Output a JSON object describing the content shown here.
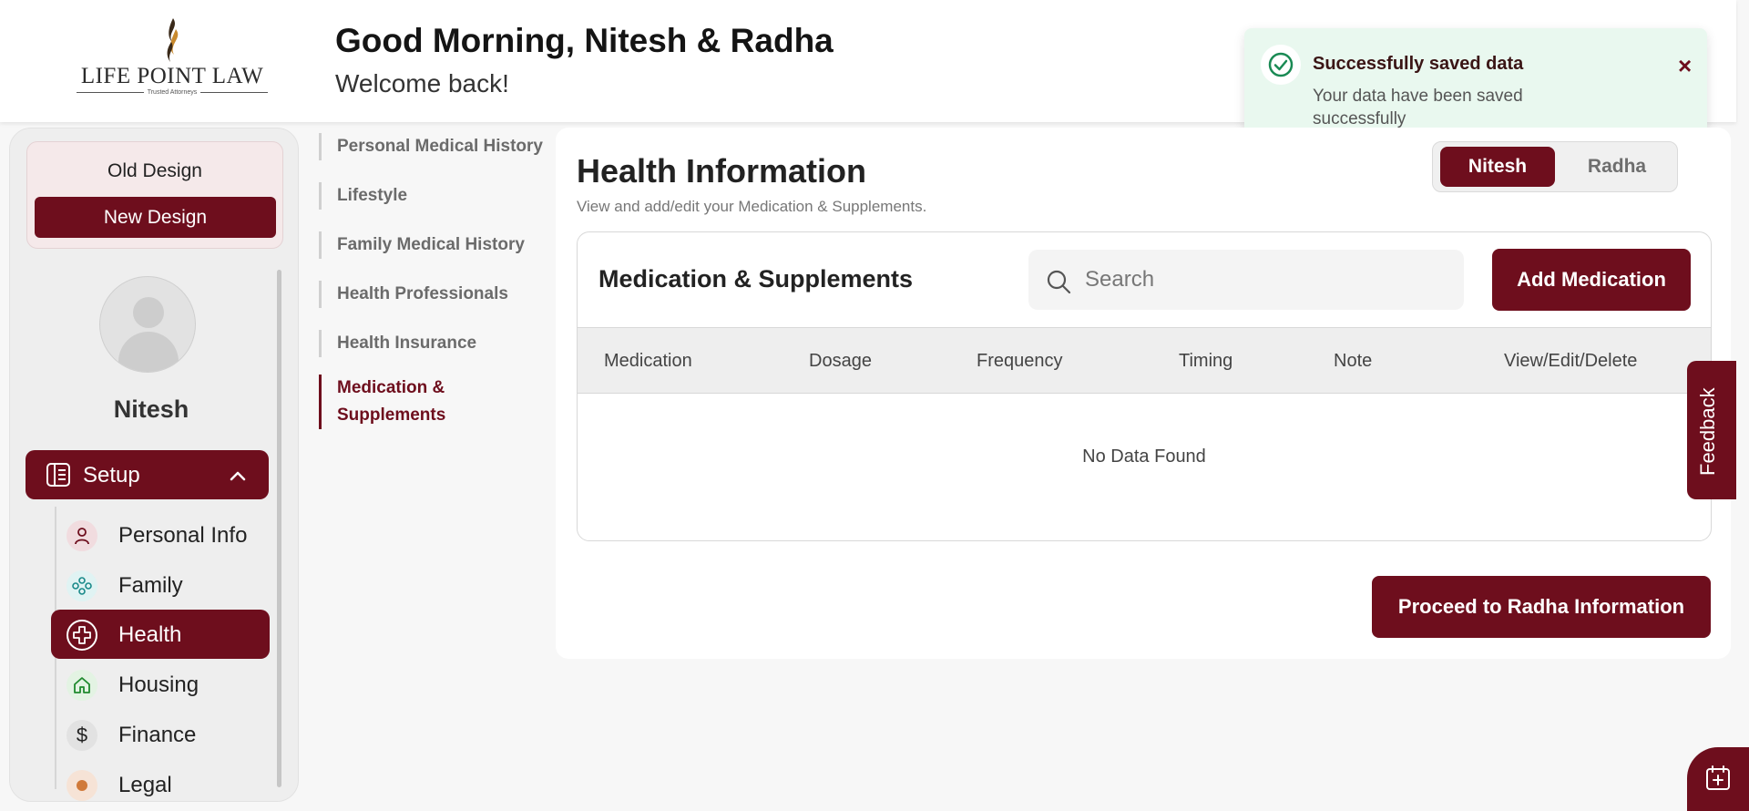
{
  "brand": {
    "logo_text": "LIFE POINT LAW",
    "tagline": "Trusted Attorneys",
    "accent_color": "#6e0e1d"
  },
  "header": {
    "greeting": "Good Morning, Nitesh & Radha",
    "subtitle": "Welcome back!"
  },
  "toast": {
    "title": "Successfully saved data",
    "message": "Your data have been saved successfully",
    "icon": "check-circle-icon",
    "close_label": "×",
    "color": "#e9f8ef"
  },
  "design_switch": {
    "old_label": "Old Design",
    "new_label": "New Design"
  },
  "user": {
    "name": "Nitesh"
  },
  "sidebar": {
    "setup_label": "Setup",
    "items": [
      {
        "label": "Personal Info",
        "icon": "person-icon",
        "active": false
      },
      {
        "label": "Family",
        "icon": "family-icon",
        "active": false
      },
      {
        "label": "Health",
        "icon": "health-cross-icon",
        "active": true
      },
      {
        "label": "Housing",
        "icon": "home-icon",
        "active": false
      },
      {
        "label": "Finance",
        "icon": "dollar-icon",
        "active": false
      },
      {
        "label": "Legal",
        "icon": "legal-icon",
        "active": false
      }
    ]
  },
  "steps": [
    {
      "label": "Personal Medical History",
      "active": false
    },
    {
      "label": "Lifestyle",
      "active": false
    },
    {
      "label": "Family Medical History",
      "active": false
    },
    {
      "label": "Health Professionals",
      "active": false
    },
    {
      "label": "Health Insurance",
      "active": false
    },
    {
      "label": "Medication &",
      "label2": "Supplements",
      "active": true
    }
  ],
  "main": {
    "title": "Health Information",
    "subtitle": "View and add/edit your Medication & Supplements.",
    "person_toggle": {
      "active": "Nitesh",
      "inactive": "Radha"
    },
    "card": {
      "title": "Medication & Supplements",
      "search_placeholder": "Search",
      "add_label": "Add Medication",
      "columns": [
        "Medication",
        "Dosage",
        "Frequency",
        "Timing",
        "Note",
        "View/Edit/Delete"
      ],
      "empty_text": "No Data Found"
    },
    "proceed_label": "Proceed to Radha Information"
  },
  "feedback_label": "Feedback"
}
